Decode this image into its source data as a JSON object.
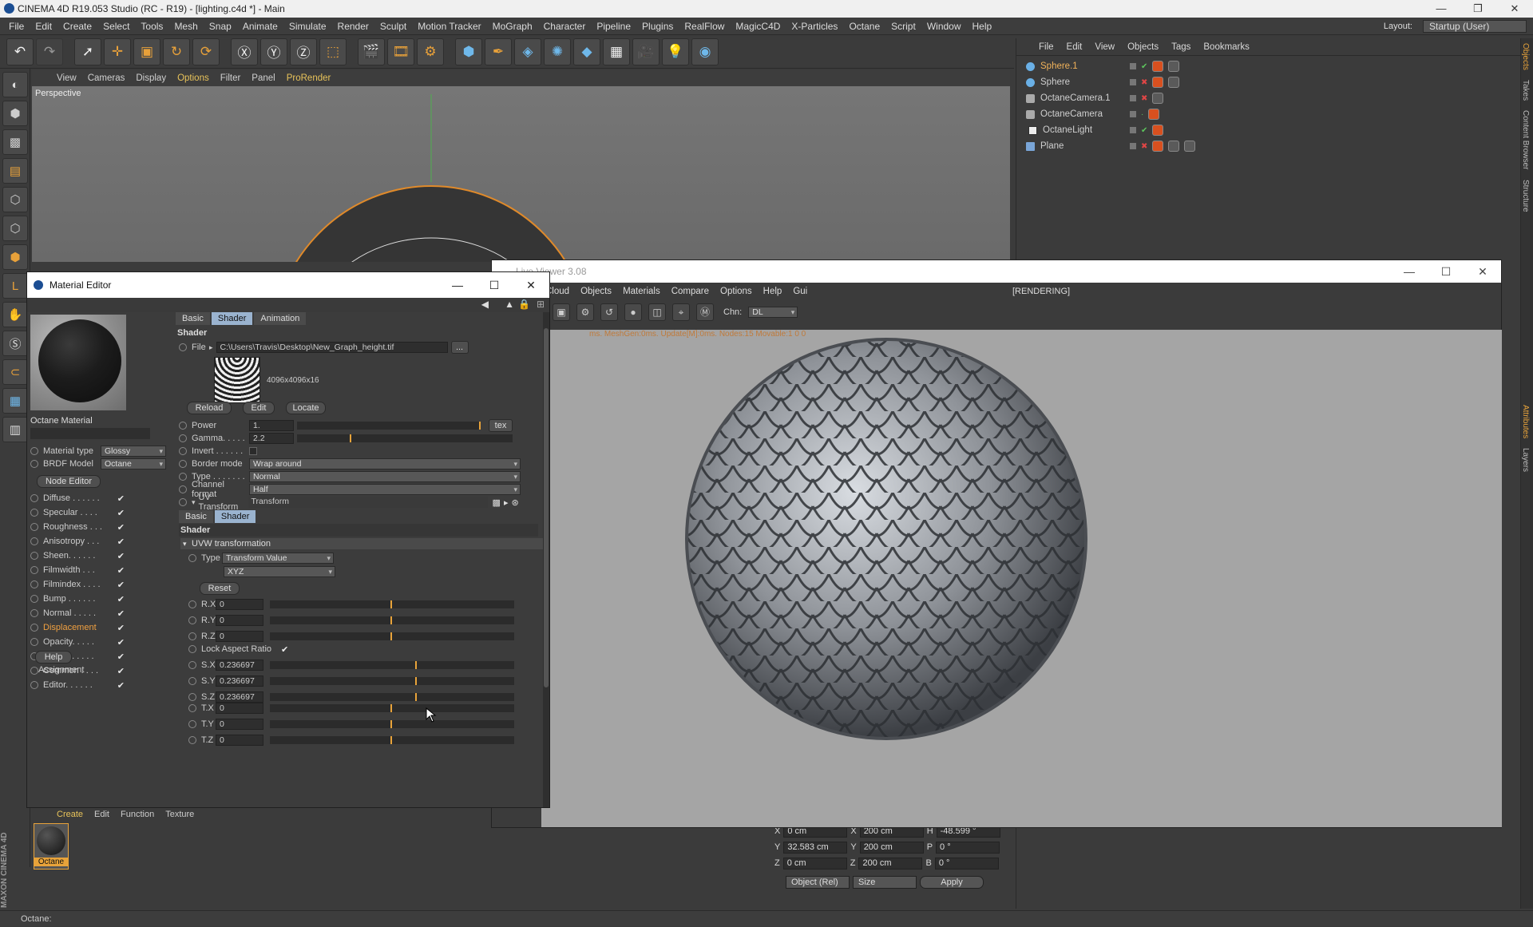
{
  "window": {
    "title": "CINEMA 4D R19.053 Studio (RC - R19) - [lighting.c4d *] - Main"
  },
  "menu": [
    "File",
    "Edit",
    "Create",
    "Select",
    "Tools",
    "Mesh",
    "Snap",
    "Animate",
    "Simulate",
    "Render",
    "Sculpt",
    "Motion Tracker",
    "MoGraph",
    "Character",
    "Pipeline",
    "Plugins",
    "RealFlow",
    "MagicC4D",
    "X-Particles",
    "Octane",
    "Script",
    "Window",
    "Help"
  ],
  "layout": {
    "label": "Layout:",
    "value": "Startup (User)"
  },
  "viewport": {
    "menu": [
      "View",
      "Cameras",
      "Display",
      "Options",
      "Filter",
      "Panel",
      "ProRender"
    ],
    "label": "Perspective"
  },
  "object_manager": {
    "menu": [
      "File",
      "Edit",
      "View",
      "Objects",
      "Tags",
      "Bookmarks"
    ],
    "objects": [
      {
        "name": "Sphere.1",
        "type": "sphere",
        "selected": true
      },
      {
        "name": "Sphere",
        "type": "sphere"
      },
      {
        "name": "OctaneCamera.1",
        "type": "camera"
      },
      {
        "name": "OctaneCamera",
        "type": "camera"
      },
      {
        "name": "OctaneLight",
        "type": "light"
      },
      {
        "name": "Plane",
        "type": "plane"
      }
    ]
  },
  "side_tabs": [
    "Objects",
    "Takes",
    "Content Browser",
    "Structure",
    "Attributes",
    "Layers"
  ],
  "material_editor": {
    "title": "Material Editor",
    "material_name": "Octane Material",
    "material_type_label": "Material type",
    "material_type": "Glossy",
    "brdf_label": "BRDF Model",
    "brdf": "Octane",
    "node_editor": "Node Editor",
    "channels": [
      {
        "label": "Diffuse . . . . . .",
        "on": "✔"
      },
      {
        "label": "Specular . . . .",
        "on": "✔"
      },
      {
        "label": "Roughness . . .",
        "on": "✔"
      },
      {
        "label": "Anisotropy . . .",
        "on": "✔"
      },
      {
        "label": "Sheen. . . . . .",
        "on": "✔"
      },
      {
        "label": "Filmwidth . . .",
        "on": "✔"
      },
      {
        "label": "Filmindex . . . .",
        "on": "✔"
      },
      {
        "label": "Bump . . . . . .",
        "on": "✔"
      },
      {
        "label": "Normal . . . . .",
        "on": "✔"
      },
      {
        "label": "Displacement",
        "on": "✔",
        "active": true
      },
      {
        "label": "Opacity. . . . .",
        "on": "✔"
      },
      {
        "label": "Index . . . . . .",
        "on": "✔"
      },
      {
        "label": "Common . . . .",
        "on": "✔"
      },
      {
        "label": "Editor. . . . . .",
        "on": "✔"
      }
    ],
    "help": "Help",
    "assignment": "Assignment",
    "tabs": [
      "Basic",
      "Shader",
      "Animation"
    ],
    "shader_header": "Shader",
    "file_label": "File",
    "file_path": "C:\\Users\\Travis\\Desktop\\New_Graph_height.tif",
    "file_btn": "...",
    "resolution": "4096x4096x16",
    "buttons": [
      "Reload",
      "Edit",
      "Locate"
    ],
    "power": {
      "label": "Power",
      "value": "1.",
      "level": 1.0,
      "tex": "tex"
    },
    "gamma": {
      "label": "Gamma. . . . .",
      "value": "2.2",
      "level": 0.25
    },
    "invert": {
      "label": "Invert . . . . . ."
    },
    "border_mode": {
      "label": "Border mode",
      "value": "Wrap around"
    },
    "type": {
      "label": "Type . . . . . . .",
      "value": "Normal"
    },
    "channel_format": {
      "label": "Channel format",
      "value": "Half"
    },
    "uv_transform": {
      "label": "UV Transform",
      "value": "Transform"
    },
    "sub_tabs": [
      "Basic",
      "Shader"
    ],
    "sub_header": "Shader",
    "uvw_group": "UVW transformation",
    "uvw_type_label": "Type",
    "uvw_type": "Transform Value",
    "uvw_order": "XYZ",
    "reset": "Reset",
    "rotation": [
      {
        "label": "R.X",
        "value": "0",
        "level": 0.5
      },
      {
        "label": "R.Y",
        "value": "0",
        "level": 0.5
      },
      {
        "label": "R.Z",
        "value": "0",
        "level": 0.5
      }
    ],
    "lock_aspect": {
      "label": "Lock Aspect Ratio",
      "on": "✔"
    },
    "scale": [
      {
        "label": "S.X",
        "value": "0.236697",
        "level": 0.6
      },
      {
        "label": "S.Y",
        "value": "0.236697",
        "level": 0.6
      },
      {
        "label": "S.Z",
        "value": "0.236697",
        "level": 0.6
      }
    ],
    "translation": [
      {
        "label": "T.X",
        "value": "0",
        "level": 0.5
      },
      {
        "label": "T.Y",
        "value": "0",
        "level": 0.5
      },
      {
        "label": "T.Z",
        "value": "0",
        "level": 0.5
      }
    ]
  },
  "live_viewer": {
    "title": "Live Viewer 3.08",
    "menu": [
      "Cloud",
      "Objects",
      "Materials",
      "Compare",
      "Options",
      "Help",
      "Gui"
    ],
    "status": "[RENDERING]",
    "chn_label": "Chn:",
    "chn": "DL",
    "stats": "ms. MeshGen:0ms. Update[M]:0ms. Nodes:15 Movable:1  0 0"
  },
  "coordinates": {
    "rows": [
      {
        "a": "X",
        "av": "0 cm",
        "b": "X",
        "bv": "200 cm",
        "c": "H",
        "cv": "-48.599 °"
      },
      {
        "a": "Y",
        "av": "32.583 cm",
        "b": "Y",
        "bv": "200 cm",
        "c": "P",
        "cv": "0 °"
      },
      {
        "a": "Z",
        "av": "0 cm",
        "b": "Z",
        "bv": "200 cm",
        "c": "B",
        "cv": "0 °"
      }
    ],
    "mode": "Object (Rel)",
    "size": "Size",
    "apply": "Apply"
  },
  "material_manager": {
    "menu": [
      "Create",
      "Edit",
      "Function",
      "Texture"
    ],
    "material": "Octane"
  },
  "status": "Octane:",
  "brand": "MAXON CINEMA 4D"
}
